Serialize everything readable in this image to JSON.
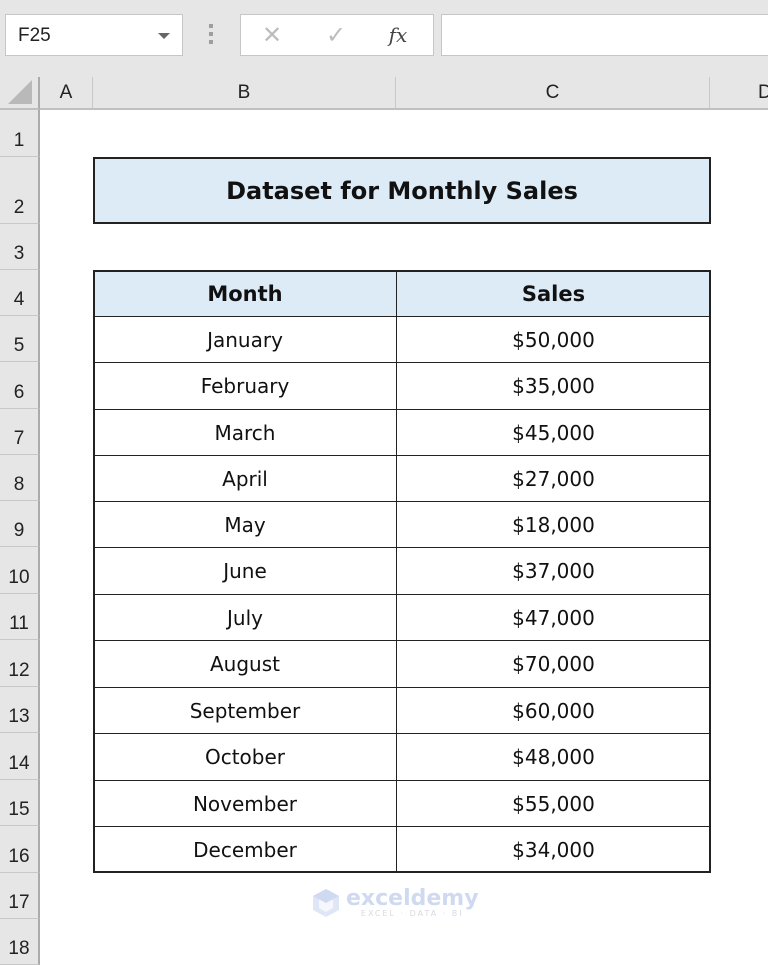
{
  "formula_bar": {
    "name_box": "F25",
    "cancel_icon": "✕",
    "enter_icon": "✓",
    "fx_label": "fx",
    "formula_value": ""
  },
  "columns": [
    "A",
    "B",
    "C",
    "D"
  ],
  "rows": [
    "1",
    "2",
    "3",
    "4",
    "5",
    "6",
    "7",
    "8",
    "9",
    "10",
    "11",
    "12",
    "13",
    "14",
    "15",
    "16",
    "17",
    "18"
  ],
  "sheet": {
    "title": "Dataset for Monthly Sales",
    "headers": [
      "Month",
      "Sales"
    ],
    "records": [
      {
        "month": "January",
        "sales": "$50,000"
      },
      {
        "month": "February",
        "sales": "$35,000"
      },
      {
        "month": "March",
        "sales": "$45,000"
      },
      {
        "month": "April",
        "sales": "$27,000"
      },
      {
        "month": "May",
        "sales": "$18,000"
      },
      {
        "month": "June",
        "sales": "$37,000"
      },
      {
        "month": "July",
        "sales": "$47,000"
      },
      {
        "month": "August",
        "sales": "$70,000"
      },
      {
        "month": "September",
        "sales": "$60,000"
      },
      {
        "month": "October",
        "sales": "$48,000"
      },
      {
        "month": "November",
        "sales": "$55,000"
      },
      {
        "month": "December",
        "sales": "$34,000"
      }
    ]
  },
  "watermark": {
    "brand": "exceldemy",
    "tagline": "EXCEL · DATA · BI"
  },
  "colors": {
    "header_fill": "#ddebf7",
    "border": "#222222",
    "chrome": "#e6e6e6"
  }
}
